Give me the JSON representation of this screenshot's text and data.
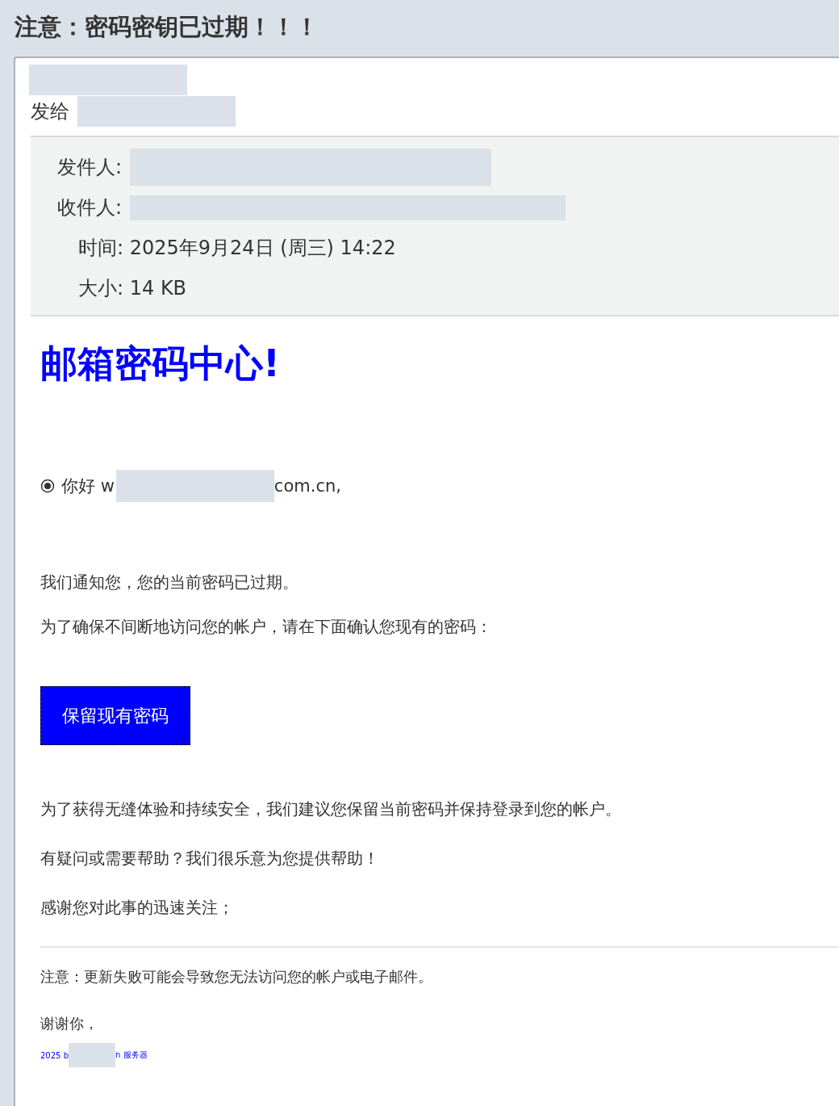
{
  "title": "注意：密码密钥已过期！！！",
  "sent_to": {
    "label": "发给"
  },
  "headers": [
    {
      "kind": "redacted",
      "label": "发件人:"
    },
    {
      "kind": "redacted",
      "label": "收件人:"
    },
    {
      "kind": "plain",
      "label": "时间:",
      "value": "2025年9月24日 (周三) 14:22"
    },
    {
      "kind": "plain",
      "label": "大小:",
      "value": "14 KB"
    }
  ],
  "heading": "邮箱密码中心!",
  "greeting": {
    "before": "你好 w",
    "after": "com.cn,"
  },
  "paragraphs_top": [
    "我们通知您，您的当前密码已过期。",
    "为了确保不间断地访问您的帐户，请在下面确认您现有的密码："
  ],
  "button": "保留现有密码",
  "paragraphs_bottom": [
    "为了获得无缝体验和持续安全，我们建议您保留当前密码并保持登录到您的帐户。",
    "有疑问或需要帮助？我们很乐意为您提供帮助！",
    "感谢您对此事的迅速关注；"
  ],
  "note": "注意：更新失败可能会导致您无法访问您的帐户或电子邮件。",
  "thanks": "谢谢你，",
  "footer": {
    "before": "2025 b",
    "after": "n 服务器"
  }
}
